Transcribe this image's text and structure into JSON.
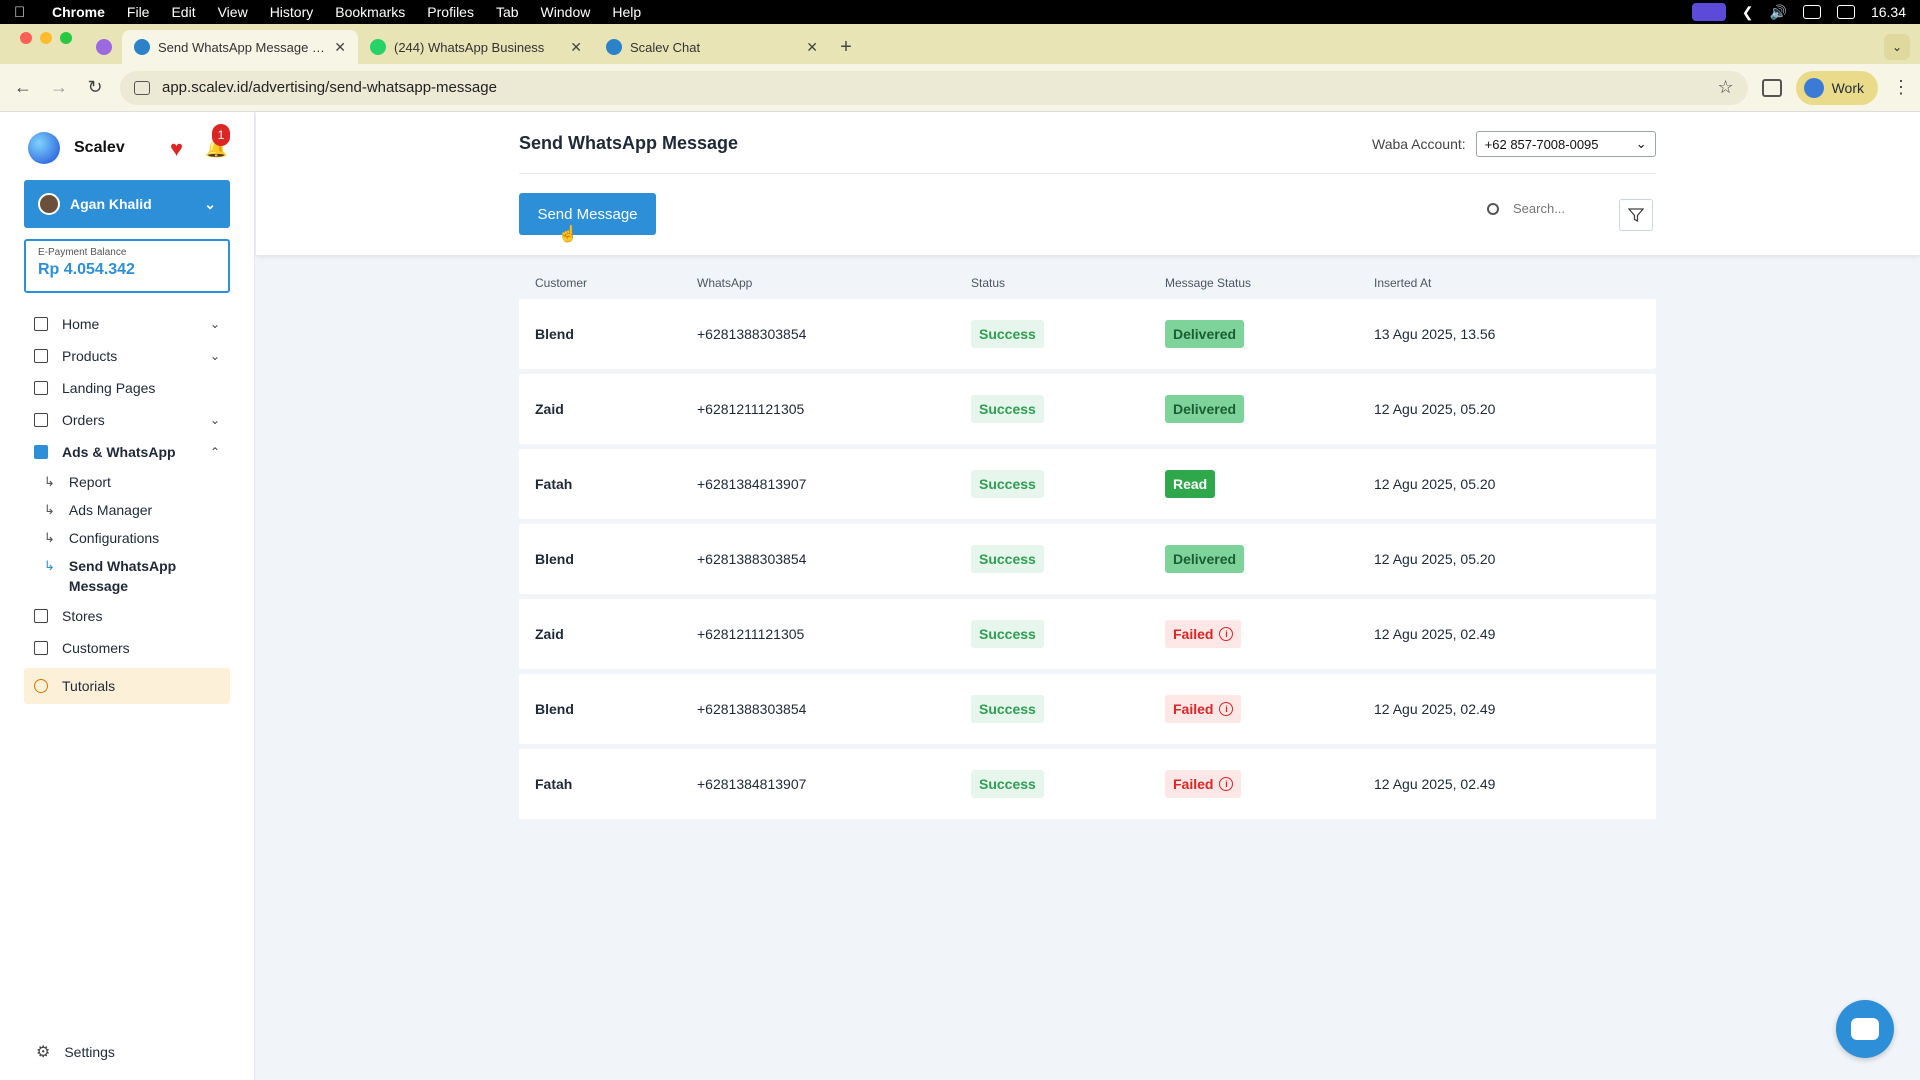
{
  "menubar": {
    "app": "Chrome",
    "items": [
      "File",
      "Edit",
      "View",
      "History",
      "Bookmarks",
      "Profiles",
      "Tab",
      "Window",
      "Help"
    ],
    "time": "16.34"
  },
  "tabs": [
    {
      "title": "Send WhatsApp Message | Sc",
      "active": true
    },
    {
      "title": "(244) WhatsApp Business",
      "active": false
    },
    {
      "title": "Scalev Chat",
      "active": false
    }
  ],
  "address": {
    "url": "app.scalev.id/advertising/send-whatsapp-message",
    "profile": "Work"
  },
  "sidebar": {
    "brand": "Scalev",
    "notification_count": "1",
    "user": "Agan Khalid",
    "balance_label": "E-Payment Balance",
    "balance_value": "Rp 4.054.342",
    "menu": [
      {
        "label": "Home"
      },
      {
        "label": "Products"
      },
      {
        "label": "Landing Pages"
      },
      {
        "label": "Orders"
      },
      {
        "label": "Ads & WhatsApp"
      }
    ],
    "submenu": [
      "Report",
      "Ads Manager",
      "Configurations",
      "Send WhatsApp Message"
    ],
    "menu2": [
      "Stores",
      "Customers",
      "Tutorials"
    ],
    "settings": "Settings"
  },
  "main": {
    "title": "Send WhatsApp Message",
    "waba_label": "Waba Account:",
    "waba_value": "+62 857-7008-0095",
    "send_button": "Send Message",
    "search_placeholder": "Search..."
  },
  "table": {
    "headers": [
      "Customer",
      "WhatsApp",
      "Status",
      "Message Status",
      "Inserted At"
    ],
    "rows": [
      {
        "customer": "Blend",
        "whatsapp": "+6281388303854",
        "status": "Success",
        "message_status": "Delivered",
        "inserted_at": "13 Agu 2025, 13.56"
      },
      {
        "customer": "Zaid",
        "whatsapp": "+6281211121305",
        "status": "Success",
        "message_status": "Delivered",
        "inserted_at": "12 Agu 2025, 05.20"
      },
      {
        "customer": "Fatah",
        "whatsapp": "+6281384813907",
        "status": "Success",
        "message_status": "Read",
        "inserted_at": "12 Agu 2025, 05.20"
      },
      {
        "customer": "Blend",
        "whatsapp": "+6281388303854",
        "status": "Success",
        "message_status": "Delivered",
        "inserted_at": "12 Agu 2025, 05.20"
      },
      {
        "customer": "Zaid",
        "whatsapp": "+6281211121305",
        "status": "Success",
        "message_status": "Failed",
        "inserted_at": "12 Agu 2025, 02.49"
      },
      {
        "customer": "Blend",
        "whatsapp": "+6281388303854",
        "status": "Success",
        "message_status": "Failed",
        "inserted_at": "12 Agu 2025, 02.49"
      },
      {
        "customer": "Fatah",
        "whatsapp": "+6281384813907",
        "status": "Success",
        "message_status": "Failed",
        "inserted_at": "12 Agu 2025, 02.49"
      }
    ]
  }
}
